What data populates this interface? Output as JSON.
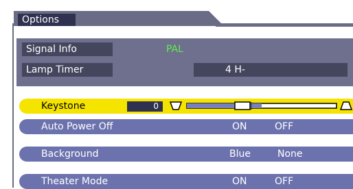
{
  "tab": {
    "label": "Options"
  },
  "info": [
    {
      "label": "Signal Info",
      "value": "PAL",
      "value_color": "#5ef04a"
    },
    {
      "label": "Lamp Timer",
      "value": "4 H-",
      "value_color": "#ffffff"
    }
  ],
  "menu": {
    "keystone": {
      "label": "Keystone",
      "value": "0",
      "level": 0.5
    },
    "auto_power_off": {
      "label": "Auto Power Off",
      "opt1": "ON",
      "opt2": "OFF"
    },
    "background": {
      "label": "Background",
      "opt1": "Blue",
      "opt2": "None"
    },
    "theater_mode": {
      "label": "Theater Mode",
      "opt1": "ON",
      "opt2": "OFF"
    }
  },
  "colors": {
    "accent": "#f5e400",
    "row": "#6c72ae",
    "panel": "#6f6f8e"
  }
}
